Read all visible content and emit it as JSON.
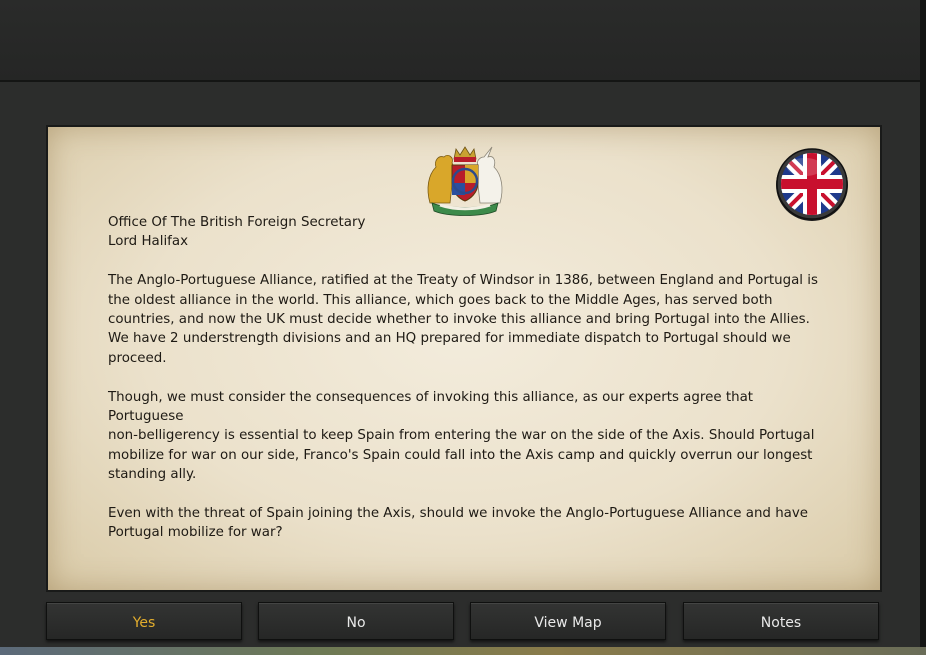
{
  "event": {
    "sender_office": "Office Of The British Foreign Secretary",
    "sender_name": "Lord Halifax",
    "paragraphs": [
      "The Anglo-Portuguese Alliance, ratified at the Treaty of Windsor in 1386, between England and Portugal is\nthe oldest alliance in the world. This alliance, which goes back to the Middle Ages, has served both\ncountries, and now the UK must decide whether to invoke this alliance and bring Portugal into the Allies.\nWe have 2 understrength divisions and an HQ prepared for immediate dispatch to Portugal should we\nproceed.",
      "Though, we must consider the consequences of invoking this alliance, as our experts agree that Portuguese\nnon-belligerency is essential to keep Spain from entering the war on the side of the Axis.  Should Portugal\nmobilize for war on our side, Franco's Spain could fall into the Axis camp and quickly overrun our longest\nstanding ally.",
      "Even with the threat of Spain joining the Axis, should we invoke the Anglo-Portuguese Alliance and have\nPortugal mobilize for war?"
    ]
  },
  "icons": {
    "crest": "royal-coat-of-arms-icon",
    "flag": "union-jack-flag-icon"
  },
  "buttons": {
    "yes": "Yes",
    "no": "No",
    "view_map": "View Map",
    "notes": "Notes"
  },
  "colors": {
    "yes_text": "#e2ad2d",
    "button_text": "#e9e9e9",
    "paper": "#efe6d2"
  }
}
